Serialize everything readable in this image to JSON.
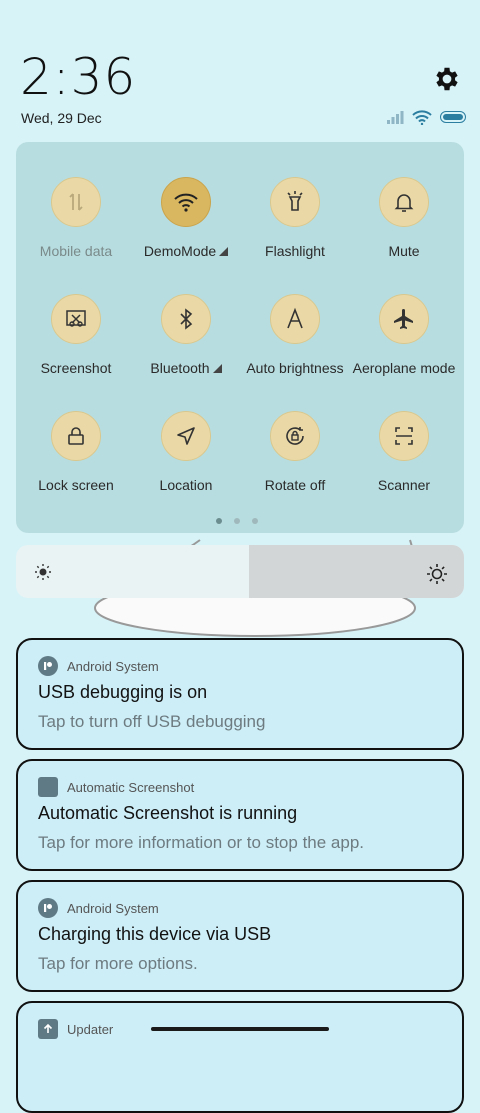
{
  "header": {
    "time": "2:36",
    "date": "Wed, 29 Dec"
  },
  "quick_tiles": [
    {
      "label": "Mobile data",
      "icon": "mobile-data-icon",
      "active": false,
      "dim": true
    },
    {
      "label": "DemoMode",
      "icon": "wifi-icon",
      "active": true,
      "expandable": true
    },
    {
      "label": "Flashlight",
      "icon": "flashlight-icon",
      "active": false
    },
    {
      "label": "Mute",
      "icon": "bell-icon",
      "active": false
    },
    {
      "label": "Screenshot",
      "icon": "screenshot-icon",
      "active": false
    },
    {
      "label": "Bluetooth",
      "icon": "bluetooth-icon",
      "active": false,
      "expandable": true
    },
    {
      "label": "Auto brightness",
      "icon": "auto-brightness-icon",
      "active": false
    },
    {
      "label": "Aeroplane mode",
      "icon": "airplane-icon",
      "active": false
    },
    {
      "label": "Lock screen",
      "icon": "lock-icon",
      "active": false
    },
    {
      "label": "Location",
      "icon": "location-icon",
      "active": false
    },
    {
      "label": "Rotate off",
      "icon": "rotate-lock-icon",
      "active": false
    },
    {
      "label": "Scanner",
      "icon": "scanner-icon",
      "active": false
    }
  ],
  "page_indicator": {
    "pages": 3,
    "current": 1
  },
  "brightness": {
    "level": 0.52
  },
  "notifications": [
    {
      "app": "Android System",
      "title": "USB debugging is on",
      "text": "Tap to turn off USB debugging",
      "icon": "android-system-icon"
    },
    {
      "app": "Automatic Screenshot",
      "title": "Automatic Screenshot is running",
      "text": "Tap for more information or to stop the app.",
      "icon": "automatic-screenshot-icon"
    },
    {
      "app": "Android System",
      "title": "Charging this device via USB",
      "text": "Tap for more options.",
      "icon": "android-system-icon"
    },
    {
      "app": "Updater",
      "title": "",
      "text": "",
      "icon": "updater-icon"
    }
  ],
  "colors": {
    "background": "#d7f3f8",
    "panel": "#b8dde0",
    "tile": "#ead9a6",
    "tile_active": "#d9b760",
    "notification": "#cdeef7"
  }
}
